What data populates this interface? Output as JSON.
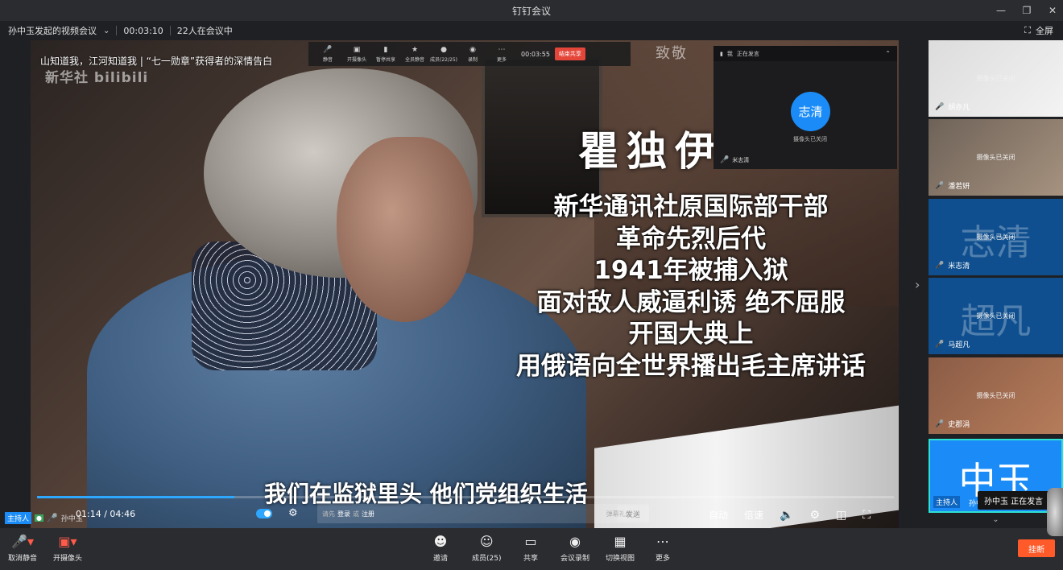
{
  "window": {
    "title": "钉钉会议"
  },
  "infobar": {
    "meeting_name": "孙中玉发起的视频会议",
    "duration": "00:03:10",
    "participants": "22人在会议中",
    "fullscreen_label": "全屏"
  },
  "video": {
    "title": "山知道我，江河知道我 | “七一勋章”获得者的深情告白",
    "watermark": "新华社 bilibili",
    "top_text": "致敬",
    "name_big": "瞿独伊",
    "captions": [
      "新华通讯社原国际部干部",
      "革命先烈后代",
      "1941年被捕入狱",
      "面对敌人威逼利诱 绝不屈服",
      "开国大典上",
      "用俄语向全世界播出毛主席讲话"
    ],
    "subtitle": "我们在监狱里头 他们党组织生活",
    "progress": 0.23,
    "time": "01:14 / 04:46",
    "danmaku_placeholder_prefix": "请先",
    "danmaku_login": "登录",
    "danmaku_or": "或",
    "danmaku_register": "注册",
    "danmaku_etiquette": "弹幕礼仪 >",
    "send_label": "发送",
    "controls": {
      "auto": "自动",
      "speed": "倍速"
    }
  },
  "float_toolbar": {
    "items": [
      "静音",
      "开摄像头",
      "暂停共享",
      "全员静音",
      "成员(22/25)",
      "录制",
      "更多"
    ],
    "time": "00:03:55",
    "stop_label": "结束共享"
  },
  "pip": {
    "header_me": "我",
    "header_status": "正在发言",
    "avatar_text": "志清",
    "camera_off": "摄像头已关闭",
    "name": "米志清"
  },
  "host": {
    "tag": "主持人",
    "name": "孙中玉"
  },
  "participants": [
    {
      "name": "胡亦凡",
      "status": "摄像头已关闭",
      "big": ""
    },
    {
      "name": "潘若妍",
      "status": "摄像头已关闭",
      "big": ""
    },
    {
      "name": "米志清",
      "status": "摄像头已关闭",
      "big": "志清"
    },
    {
      "name": "马超凡",
      "status": "摄像头已关闭",
      "big": "超凡"
    },
    {
      "name": "史郡涓",
      "status": "摄像头已关闭",
      "big": ""
    },
    {
      "name": "孙中玉",
      "status": "",
      "big": "中玉"
    }
  ],
  "speaking_popup": "孙中玉 正在发言",
  "bottom": {
    "unmute": "取消静音",
    "camera": "开摄像头",
    "invite": "邀请",
    "members": "成员(25)",
    "share": "共享",
    "record": "会议录制",
    "switch_view": "切换视图",
    "more": "更多",
    "hangup": "挂断"
  },
  "colors": {
    "accent": "#1b8cf7",
    "danger": "#ff5a2a",
    "speaking_border": "#2ee0d2"
  }
}
